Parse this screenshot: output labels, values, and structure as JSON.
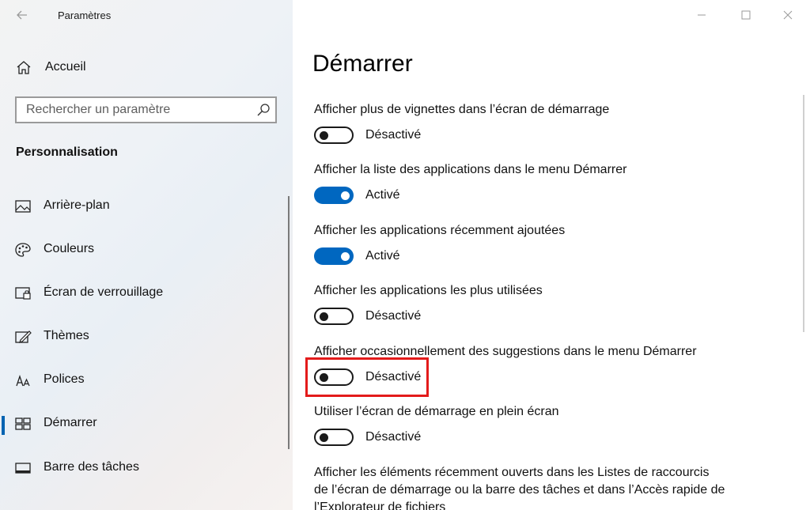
{
  "window": {
    "title": "Paramètres",
    "back_icon": "back-arrow-icon",
    "controls": [
      "minimize-icon",
      "maximize-icon",
      "close-icon"
    ]
  },
  "sidebar": {
    "home_label": "Accueil",
    "search_placeholder": "Rechercher un paramètre",
    "section_title": "Personnalisation",
    "items": [
      {
        "label": "Arrière-plan",
        "icon": "picture-icon",
        "selected": false
      },
      {
        "label": "Couleurs",
        "icon": "palette-icon",
        "selected": false
      },
      {
        "label": "Écran de verrouillage",
        "icon": "lock-screen-icon",
        "selected": false
      },
      {
        "label": "Thèmes",
        "icon": "themes-icon",
        "selected": false
      },
      {
        "label": "Polices",
        "icon": "fonts-icon",
        "selected": false
      },
      {
        "label": "Démarrer",
        "icon": "start-icon",
        "selected": true
      },
      {
        "label": "Barre des tâches",
        "icon": "taskbar-icon",
        "selected": false
      }
    ]
  },
  "main": {
    "title": "Démarrer",
    "settings": [
      {
        "label": "Afficher plus de vignettes dans l’écran de démarrage",
        "state": "Désactivé",
        "on": false
      },
      {
        "label": "Afficher la liste des applications dans le menu Démarrer",
        "state": "Activé",
        "on": true
      },
      {
        "label": "Afficher les applications récemment ajoutées",
        "state": "Activé",
        "on": true
      },
      {
        "label": "Afficher les applications les plus utilisées",
        "state": "Désactivé",
        "on": false
      },
      {
        "label": "Afficher occasionnellement des suggestions dans le menu Démarrer",
        "state": "Désactivé",
        "on": false,
        "highlighted": true
      },
      {
        "label": "Utiliser l’écran de démarrage en plein écran",
        "state": "Désactivé",
        "on": false
      }
    ],
    "long_setting_label": "Afficher les éléments récemment ouverts dans les Listes de raccourcis de l’écran de démarrage ou la barre des tâches et dans l’Accès rapide de l’Explorateur de fichiers"
  },
  "colors": {
    "accent": "#0067c0",
    "highlight": "#e31b1b"
  }
}
